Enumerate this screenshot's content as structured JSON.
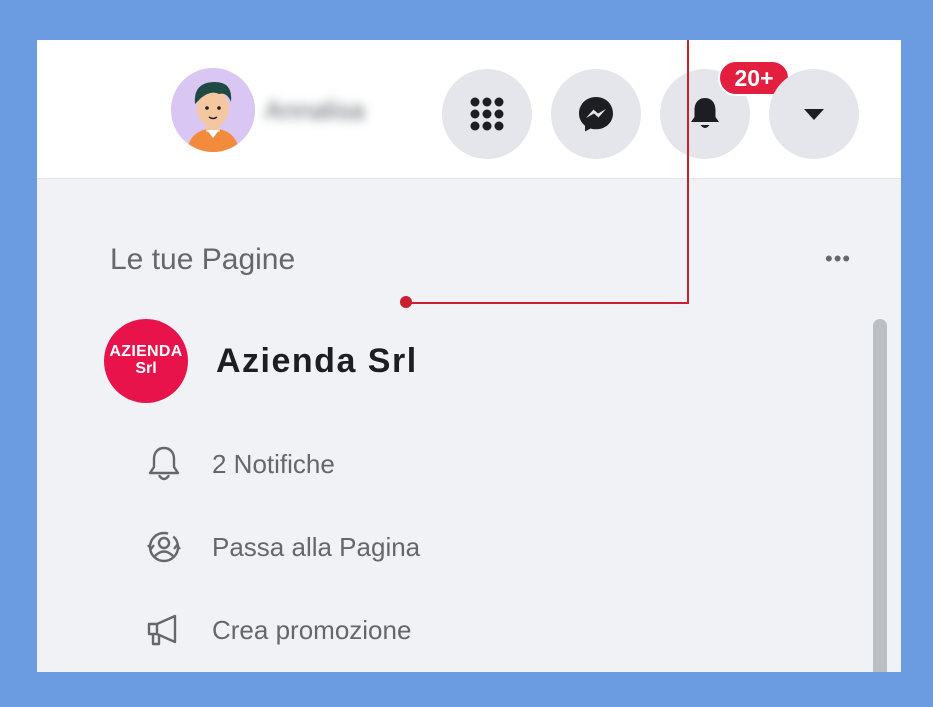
{
  "header": {
    "profile_name": "Annalisa",
    "notification_badge": "20+"
  },
  "pages_section": {
    "title": "Le tue Pagine",
    "more_label": "•••"
  },
  "page": {
    "logo_line1": "AZIENDA",
    "logo_line2": "Srl",
    "name": "Azienda Srl",
    "logo_color": "#e8134a"
  },
  "actions": [
    {
      "icon": "bell-outline-icon",
      "label": "2 Notifiche"
    },
    {
      "icon": "switch-profile-icon",
      "label": "Passa alla Pagina"
    },
    {
      "icon": "megaphone-icon",
      "label": "Crea promozione"
    }
  ],
  "colors": {
    "frame_background": "#6b9be0",
    "badge": "#e41e3f",
    "callout": "#c8202f"
  }
}
